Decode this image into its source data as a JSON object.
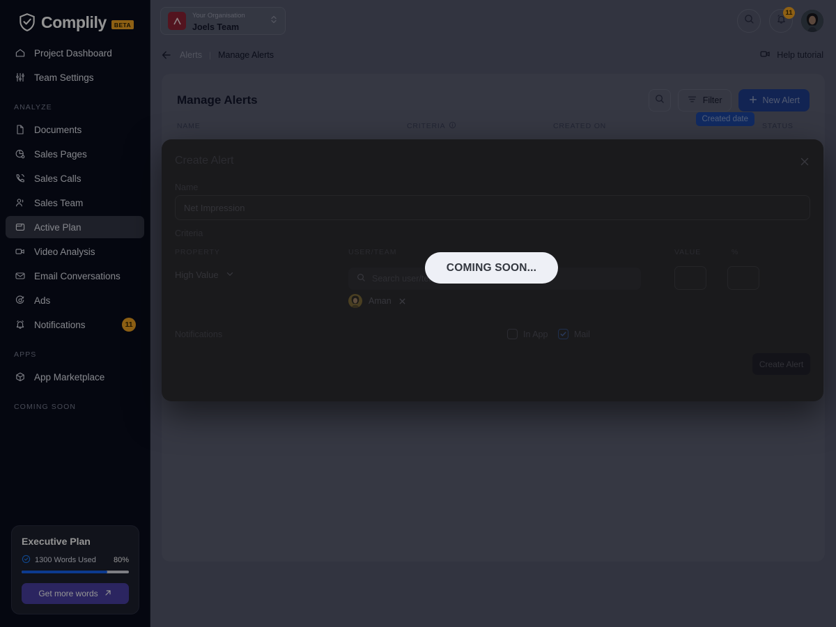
{
  "brand": {
    "name": "Complily",
    "badge": "BETA",
    "logo_icon": "shield-check-icon"
  },
  "sidebar": {
    "items": [
      {
        "label": "Project Dashboard",
        "icon": "home-icon",
        "active": false
      },
      {
        "label": "Team Settings",
        "icon": "sliders-icon",
        "active": false
      }
    ],
    "sections": [
      {
        "title": "ANALYZE",
        "items": [
          {
            "label": "Documents",
            "icon": "document-icon",
            "active": false
          },
          {
            "label": "Sales Pages",
            "icon": "pie-chart-icon",
            "active": false
          },
          {
            "label": "Sales Calls",
            "icon": "phone-icon",
            "active": false
          },
          {
            "label": "Sales Team",
            "icon": "users-icon",
            "active": false
          },
          {
            "label": "Active Plan",
            "icon": "folder-icon",
            "active": true
          },
          {
            "label": "Video Analysis",
            "icon": "video-icon",
            "active": false
          },
          {
            "label": "Email Conversations",
            "icon": "mail-icon",
            "active": false
          },
          {
            "label": "Ads",
            "icon": "target-icon",
            "active": false
          },
          {
            "label": "Notifications",
            "icon": "bell-icon",
            "active": false,
            "badge": "11"
          }
        ]
      },
      {
        "title": "APPS",
        "items": [
          {
            "label": "App Marketplace",
            "icon": "cube-icon",
            "active": false
          }
        ]
      },
      {
        "title": "COMING SOON",
        "items": []
      }
    ],
    "plan_card": {
      "title": "Executive Plan",
      "usage_label": "1300 Words Used",
      "percent_label": "80%",
      "progress": 80,
      "cta_label": "Get more words",
      "check_icon": "check-circle-icon",
      "cta_icon": "arrow-up-right-icon",
      "accent": "#4b41a6",
      "bar_color": "#1565f5"
    }
  },
  "topbar": {
    "org": {
      "sub_label": "Your Organisation",
      "name": "Joels Team",
      "logo_letter": "Λ",
      "logo_color": "#8f2436",
      "chevron_icon": "chevron-up-down-icon"
    },
    "search_icon": "search-icon",
    "notifications": {
      "icon": "bell-icon",
      "badge": "11"
    },
    "avatar": {
      "icon": "user-avatar"
    }
  },
  "breadcrumb": {
    "back_icon": "arrow-left-icon",
    "parent": "Alerts",
    "separator": "|",
    "current": "Manage Alerts",
    "help": {
      "label": "Help tutorial",
      "icon": "video-camera-icon"
    }
  },
  "panel": {
    "title": "Manage Alerts",
    "search_icon": "search-icon",
    "filter": {
      "label": "Filter",
      "icon": "filter-icon"
    },
    "new_alert": {
      "label": "New Alert",
      "icon": "plus-icon"
    },
    "created_chip": "Created date",
    "table_headers": [
      "NAME",
      "CRITERIA",
      "CREATED ON",
      "STATUS"
    ],
    "criteria_info_icon": "info-icon"
  },
  "modal": {
    "title": "Create Alert",
    "close_icon": "close-icon",
    "name_label": "Name",
    "name_value": "Net Impression",
    "criteria_label": "Criteria",
    "columns": {
      "property": "PROPERTY",
      "user_team": "USER/TEAM",
      "value": "VALUE",
      "percent": "%"
    },
    "property_value": "High Value",
    "property_chevron_icon": "chevron-down-icon",
    "user_search_placeholder": "Search user/team",
    "user_search_icon": "search-icon",
    "selected_user": {
      "name": "Aman",
      "remove_icon": "close-icon"
    },
    "value_input": "",
    "percent_input": "",
    "notifications_label": "Notifications",
    "checkboxes": [
      {
        "label": "In App",
        "checked": false
      },
      {
        "label": "Mail",
        "checked": true
      }
    ],
    "submit_label": "Create Alert"
  },
  "tooltip": {
    "text": "COMING SOON..."
  }
}
